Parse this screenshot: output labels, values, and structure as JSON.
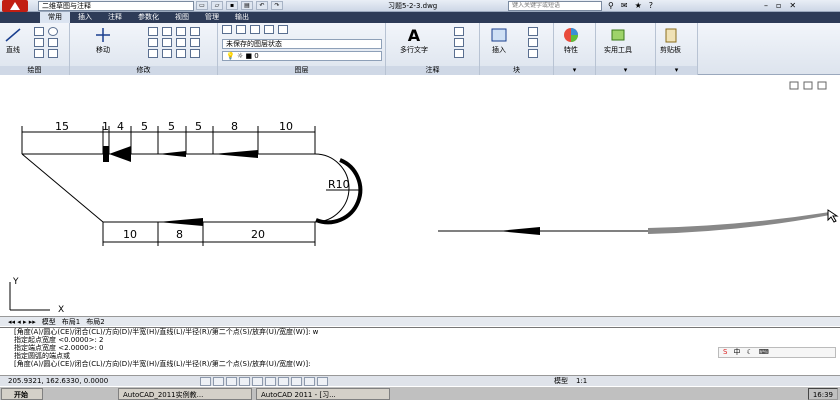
{
  "titlebar": {
    "workspace": "二维草图与注释",
    "doc_title": "习题5-2-3.dwg",
    "search_placeholder": "键入关键字或短语"
  },
  "tabs": [
    "常用",
    "插入",
    "注释",
    "参数化",
    "视图",
    "管理",
    "输出"
  ],
  "ribbon": {
    "line": "直线",
    "move": "移动",
    "layer_state": "未保存的图层状态",
    "layer_value": "0",
    "mtext": "多行文字",
    "insert": "插入",
    "properties": "特性",
    "utilities": "实用工具",
    "clipboard": "剪贴板",
    "panels": {
      "draw": "绘图",
      "modify": "修改",
      "layers": "图层",
      "annotation": "注释",
      "block": "块"
    }
  },
  "drawing": {
    "dims_top": [
      "15",
      "1",
      "4",
      "5",
      "5",
      "5",
      "8",
      "10"
    ],
    "dims_bottom": [
      "10",
      "8",
      "20"
    ],
    "radius_label": "R10",
    "ucs_x": "X",
    "ucs_y": "Y"
  },
  "layout_tabs": [
    "模型",
    "布局1",
    "布局2"
  ],
  "command_lines": [
    "[角度(A)/圆心(CE)/闭合(CL)/方向(D)/半宽(H)/直线(L)/半径(R)/第二个点(S)/放弃(U)/宽度(W)]: w",
    "指定起点宽度 <0.0000>: 2",
    "指定端点宽度 <2.0000>: 0",
    "指定圆弧的端点或",
    "[角度(A)/圆心(CE)/闭合(CL)/方向(D)/半宽(H)/直线(L)/半径(R)/第二个点(S)/放弃(U)/宽度(W)]:"
  ],
  "statusbar": {
    "coords": "205.9321, 162.6330, 0.0000",
    "model": "模型",
    "scale": "1:1"
  },
  "taskbar": {
    "start": "开始",
    "task1": "AutoCAD_2011实例教...",
    "task2": "AutoCAD 2011 - [习...",
    "clock": "16:39"
  },
  "ime": {
    "label": "中"
  }
}
